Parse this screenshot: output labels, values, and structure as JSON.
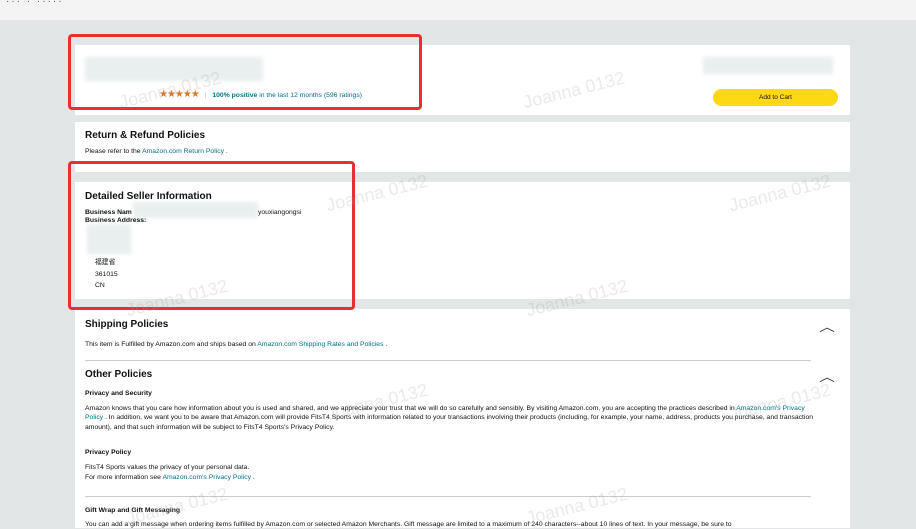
{
  "top": {
    "crumb": "··· · ·····"
  },
  "seller": {
    "rating_stars": "★★★★★",
    "rating_positive": "100% positive",
    "rating_period": " in the last 12 months ",
    "rating_count": "(596 ratings)",
    "add_to_cart": "Add to Cart"
  },
  "returns": {
    "title": "Return & Refund Policies",
    "text_prefix": "Please refer to the ",
    "link": "Amazon.com Return Policy",
    "text_suffix": " ."
  },
  "detailed": {
    "title": "Detailed Seller Information",
    "business_name_label": "Business Nam",
    "business_name_value": "youxiangongsi",
    "business_address_label": "Business Address:",
    "address_lines": [
      "福建省",
      "361015",
      "CN"
    ]
  },
  "shipping": {
    "title": "Shipping Policies",
    "text_prefix": "This item is Fulfilled by Amazon.com and ships based on ",
    "link": "Amazon.com Shipping Rates and Policies",
    "text_suffix": " ."
  },
  "other": {
    "title": "Other Policies",
    "privacy_security_title": "Privacy and Security",
    "privacy_security_text1": "Amazon knows that you care how information about you is used and shared, and we appreciate your trust that we will do so carefully and sensibly. By visiting Amazon.com, you are accepting the practices described in",
    "privacy_security_link": "Amazon.com's Privacy Policy",
    "privacy_security_text2": " . In addition, we want you to be aware that Amazon.com will provide FitsT4 Sports with information related to your transactions involving their products (including, for example, your name, address, products you purchase, and transaction amount), and that such information will be subject to FitsT4 Sports's Privacy Policy.",
    "privacy_policy_title": "Privacy Policy",
    "privacy_policy_text1": "FitsT4 Sports values the privacy of your personal data.",
    "privacy_policy_text2_prefix": "For more information see ",
    "privacy_policy_link": "Amazon.com's Privacy Policy",
    "privacy_policy_text2_suffix": " .",
    "gift_title": "Gift Wrap and Gift Messaging",
    "gift_text": "You can add a gift message when ordering items fulfilled by Amazon.com or selected Amazon Merchants. Gift message are limited to a maximum of 240 characters--about 10 lines of text. In your message, be sure to"
  },
  "watermark": "Joanna 0132"
}
